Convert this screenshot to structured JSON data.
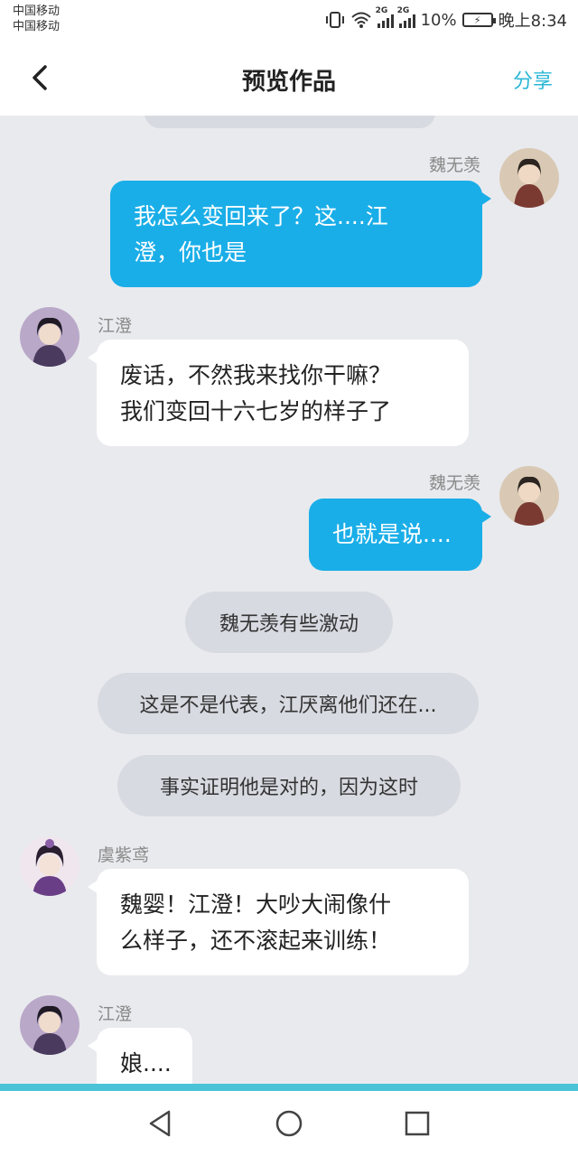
{
  "status_bar": {
    "carrier_1": "中国移动",
    "carrier_2": "中国移动",
    "signal_tag_1": "2G",
    "signal_tag_2": "2G",
    "battery": "10%",
    "time": "晚上8:34"
  },
  "header": {
    "back_icon": "chevron-left-icon",
    "title": "预览作品",
    "share_label": "分享",
    "accent_color": "#2bb7d6"
  },
  "messages": [
    {
      "type": "right",
      "name": "魏无羡",
      "line1": "我怎么变回来了？这....江",
      "line2": "澄，你也是"
    },
    {
      "type": "left",
      "name": "江澄",
      "line1": "废话，不然我来找你干嘛？",
      "line2": "我们变回十六七岁的样子了"
    },
    {
      "type": "right",
      "name": "魏无羡",
      "text": "也就是说...."
    },
    {
      "type": "narration",
      "text": "魏无羡有些激动"
    },
    {
      "type": "narration",
      "text": "这是不是代表，江厌离他们还在..."
    },
    {
      "type": "narration",
      "text": "事实证明他是对的，因为这时"
    },
    {
      "type": "left",
      "name": "虞紫鸢",
      "line1": "魏婴！江澄！大吵大闹像什",
      "line2": "么样子，还不滚起来训练！"
    },
    {
      "type": "left",
      "name": "江澄",
      "text": "娘...."
    }
  ],
  "colors": {
    "right_bubble": "#1aaee8",
    "background": "#e9eaee",
    "narration_bg": "#d8dae1"
  },
  "navbar": {
    "back": "triangle-back-icon",
    "home": "circle-home-icon",
    "recents": "square-recents-icon"
  }
}
